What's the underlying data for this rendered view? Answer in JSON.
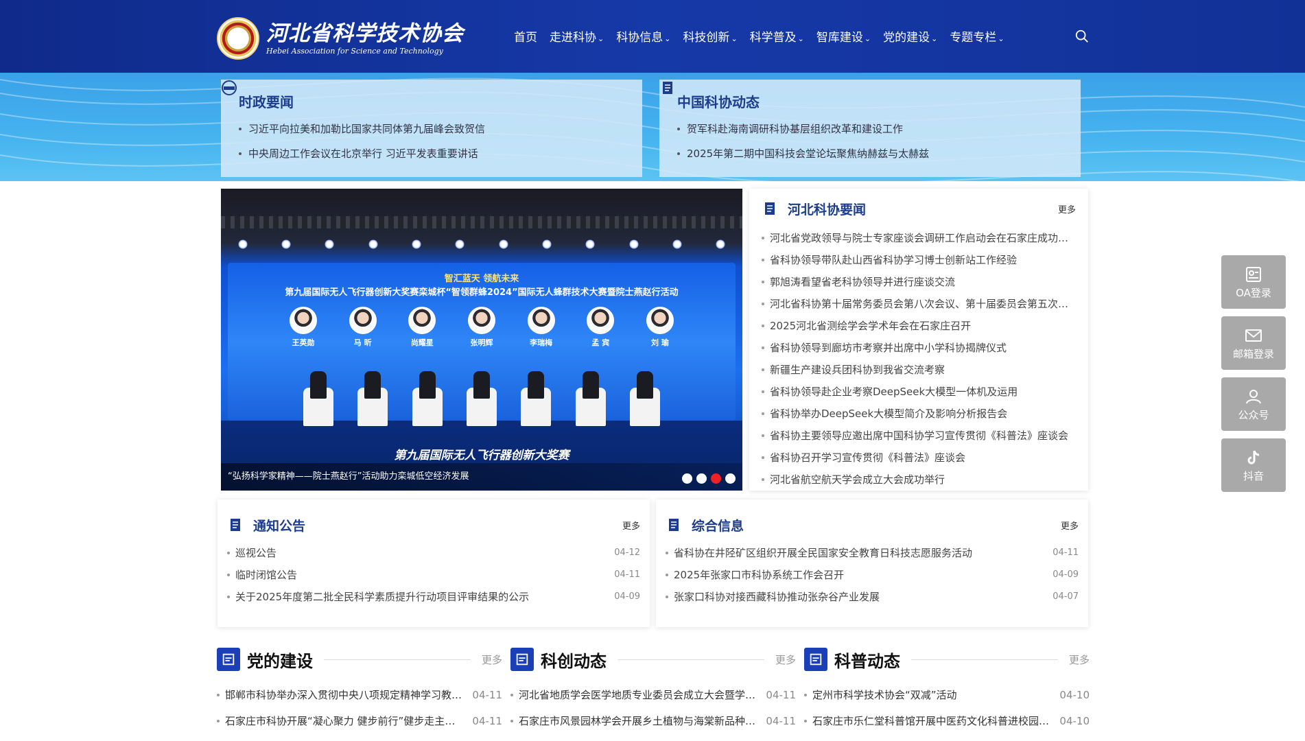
{
  "header": {
    "logo_cn": "河北省科学技术协会",
    "logo_en": "Hebei Association for Science and Technology",
    "nav": [
      {
        "label": "首页",
        "dropdown": false
      },
      {
        "label": "走进科协",
        "dropdown": true
      },
      {
        "label": "科协信息",
        "dropdown": true
      },
      {
        "label": "科技创新",
        "dropdown": true
      },
      {
        "label": "科学普及",
        "dropdown": true
      },
      {
        "label": "智库建设",
        "dropdown": true
      },
      {
        "label": "党的建设",
        "dropdown": true
      },
      {
        "label": "专题专栏",
        "dropdown": true
      }
    ],
    "search_icon": "search-icon"
  },
  "banner": {
    "left": {
      "title": "时政要闻",
      "icon": "news-globe-icon",
      "items": [
        "习近平向拉美和加勒比国家共同体第九届峰会致贺信",
        "中央周边工作会议在北京举行 习近平发表重要讲话"
      ]
    },
    "right": {
      "title": "中国科协动态",
      "icon": "document-icon",
      "items": [
        "贺军科赴海南调研科协基层组织改革和建设工作",
        "2025年第二期中国科技会堂论坛聚焦纳赫兹与太赫兹"
      ]
    }
  },
  "slideshow": {
    "screen_line1": "智汇蓝天 领航未来",
    "screen_line2": "第九届国际无人飞行器创新大奖赛栾城杯“智领群蜂2024”国际无人蜂群技术大赛暨院士燕赵行活动",
    "people": [
      "王英勋",
      "马 昕",
      "尚耀星",
      "张明辉",
      "李瑞梅",
      "孟 宾",
      "刘 瑜"
    ],
    "stage_text": "第九届国际无人飞行器创新大奖赛",
    "caption": "“弘扬科学家精神——院士燕赵行”活动助力栾城低空经济发展",
    "dots": 4,
    "active_dot": 2
  },
  "hebei_news": {
    "title": "河北科协要闻",
    "more": "更多",
    "items": [
      "河北省党政领导与院士专家座谈会调研工作启动会在石家庄成功举行",
      "省科协领导带队赴山西省科协学习博士创新站工作经验",
      "郭旭涛看望省老科协领导并进行座谈交流",
      "河北省科协第十届常务委员会第八次会议、第十届委员会第五次全体会议召开",
      "2025河北省测绘学会学术年会在石家庄召开",
      "省科协领导到廊坊市考察并出席中小学科协揭牌仪式",
      "新疆生产建设兵团科协到我省交流考察",
      "省科协领导赴企业考察DeepSeek大模型一体机及运用",
      "省科协举办DeepSeek大模型简介及影响分析报告会",
      "省科协主要领导应邀出席中国科协学习宣传贯彻《科普法》座谈会",
      "省科协召开学习宣传贯彻《科普法》座谈会",
      "河北省航空航天学会成立大会成功举行"
    ]
  },
  "notice": {
    "title": "通知公告",
    "more": "更多",
    "items": [
      {
        "text": "巡视公告",
        "date": "04-12"
      },
      {
        "text": "临时闭馆公告",
        "date": "04-11"
      },
      {
        "text": "关于2025年度第二批全民科学素质提升行动项目评审结果的公示",
        "date": "04-09"
      }
    ]
  },
  "info": {
    "title": "综合信息",
    "more": "更多",
    "items": [
      {
        "text": "省科协在井陉矿区组织开展全民国家安全教育日科技志愿服务活动",
        "date": "04-11"
      },
      {
        "text": "2025年张家口市科协系统工作会召开",
        "date": "04-09"
      },
      {
        "text": "张家口科协对接西藏科协推动张杂谷产业发展",
        "date": "04-07"
      }
    ]
  },
  "columns": [
    {
      "title": "党的建设",
      "more": "更多",
      "items": [
        {
          "text": "邯郸市科协举办深入贯彻中央八项规定精神学习教育读书班",
          "date": "04-11"
        },
        {
          "text": "石家庄市科协开展“凝心聚力 健步前行”健步走主题活动",
          "date": "04-11"
        }
      ]
    },
    {
      "title": "科创动态",
      "more": "更多",
      "items": [
        {
          "text": "河北省地质学会医学地质专业委员会成立大会暨学术研讨会召开",
          "date": "04-11"
        },
        {
          "text": "石家庄市风景园林学会开展乡土植物与海棠新品种推介活动",
          "date": "04-11"
        }
      ]
    },
    {
      "title": "科普动态",
      "more": "更多",
      "items": [
        {
          "text": "定州市科学技术协会“双减”活动",
          "date": "04-10"
        },
        {
          "text": "石家庄市乐仁堂科普馆开展中医药文化科普进校园活动",
          "date": "04-10"
        }
      ]
    }
  ],
  "side": [
    {
      "label": "OA登录",
      "icon": "id-card-icon"
    },
    {
      "label": "邮箱登录",
      "icon": "mail-icon"
    },
    {
      "label": "公众号",
      "icon": "users-icon"
    },
    {
      "label": "抖音",
      "icon": "tiktok-icon"
    }
  ],
  "colors": {
    "header_bg": "#1639a8",
    "banner_bg": "#46b3ef",
    "title_blue": "#1c3c8e",
    "active_dot": "#e22222"
  }
}
